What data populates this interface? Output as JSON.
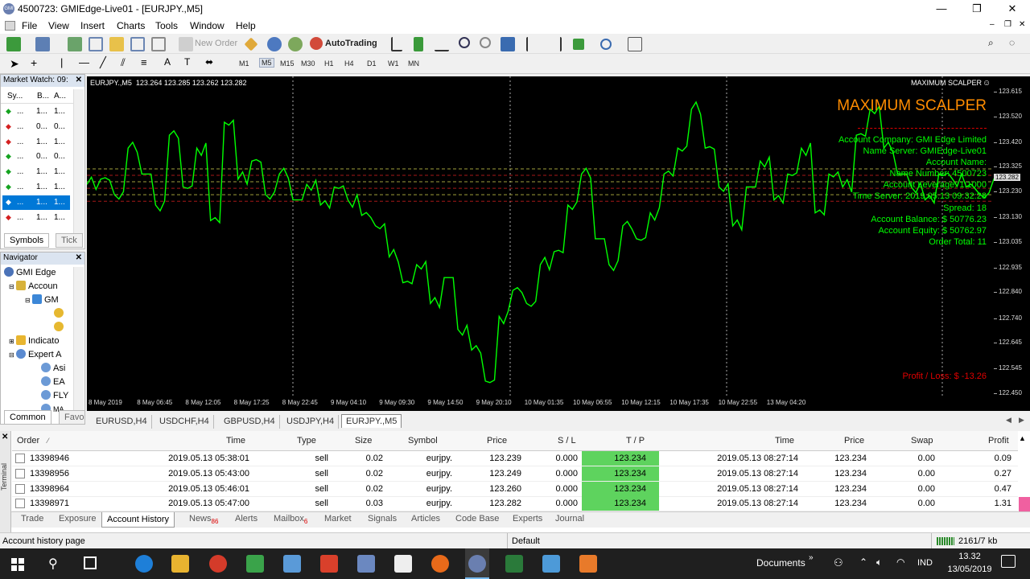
{
  "window": {
    "title": "4500723: GMIEdge-Live01 - [EURJPY.,M5]",
    "app_icon_text": "GMI",
    "minimize_glyph": "—",
    "restore_glyph": "❐",
    "close_glyph": "✕"
  },
  "menu": [
    "File",
    "View",
    "Insert",
    "Charts",
    "Tools",
    "Window",
    "Help"
  ],
  "toolbar": {
    "new_order_label": "New Order",
    "autotrading_label": "AutoTrading",
    "timeframes": [
      "M1",
      "M5",
      "M15",
      "M30",
      "H1",
      "H4",
      "D1",
      "W1",
      "MN"
    ],
    "active_timeframe": "M5"
  },
  "market_watch": {
    "title": "Market Watch: 09:",
    "columns": [
      "Sy...",
      "B...",
      "A..."
    ],
    "rows": [
      {
        "dir": "up",
        "sym": "...",
        "bid": "1...",
        "ask": "1..."
      },
      {
        "dir": "down",
        "sym": "...",
        "bid": "0...",
        "ask": "0..."
      },
      {
        "dir": "down",
        "sym": "...",
        "bid": "1...",
        "ask": "1..."
      },
      {
        "dir": "up",
        "sym": "...",
        "bid": "0...",
        "ask": "0..."
      },
      {
        "dir": "up",
        "sym": "...",
        "bid": "1...",
        "ask": "1..."
      },
      {
        "dir": "up",
        "sym": "...",
        "bid": "1...",
        "ask": "1..."
      },
      {
        "dir": "down",
        "sym": "...",
        "bid": "1...",
        "ask": "1..."
      },
      {
        "dir": "down",
        "sym": "...",
        "bid": "1...",
        "ask": "1..."
      }
    ],
    "selected_row": 6,
    "tabs": [
      "Symbols",
      "Tick"
    ]
  },
  "navigator": {
    "title": "Navigator",
    "items": [
      "GMI Edge",
      "Accoun",
      "GM",
      "Indicato",
      "Expert A",
      "Asi",
      "EA",
      "FLY",
      "MA"
    ],
    "tabs": [
      "Common",
      "Favo"
    ]
  },
  "chart": {
    "header": "EURJPY.,M5  123.264 123.285 123.262 123.282",
    "ea_label": "MAXIMUM SCALPER",
    "ea_title": "MAXIMUM SCALPER",
    "info_lines": [
      "Account Company: GMI Edge Limited",
      "Name Server: GMIEdge-Live01",
      "Account Name:",
      "Name Number: 4500723",
      "Account Leverage: 1:1000",
      "Time Server: 2019.05.13 09:32:28",
      "Spread: 18",
      "Account Balance: $ 50776.23",
      "Account Equity: $ 50762.97",
      "Order Total: 11"
    ],
    "profit_loss": "Profit / Loss: $ -13.26",
    "current_price": "123.282",
    "price_ticks": [
      "123.615",
      "123.520",
      "123.420",
      "123.325",
      "123.230",
      "123.130",
      "123.035",
      "122.935",
      "122.840",
      "122.740",
      "122.645",
      "122.545",
      "122.450"
    ],
    "time_ticks": [
      "8 May 2019",
      "8 May 06:45",
      "8 May 12:05",
      "8 May 17:25",
      "8 May 22:45",
      "9 May 04:10",
      "9 May 09:30",
      "9 May 14:50",
      "9 May 20:10",
      "10 May 01:35",
      "10 May 06:55",
      "10 May 12:15",
      "10 May 17:35",
      "10 May 22:55",
      "13 May 04:20"
    ],
    "price_series": [
      123.26,
      123.28,
      123.22,
      123.4,
      123.3,
      123.18,
      123.45,
      123.25,
      123.4,
      123.12,
      123.5,
      123.28,
      123.35,
      123.22,
      123.3,
      123.2,
      123.26,
      123.18,
      123.25,
      123.2,
      123.14,
      123.1,
      122.98,
      122.88,
      122.95,
      122.8,
      122.9,
      122.7,
      122.62,
      122.5,
      122.75,
      122.85,
      122.8,
      122.95,
      123.0,
      123.18,
      123.3,
      123.05,
      122.95,
      123.1,
      123.05,
      123.15,
      123.3,
      123.4,
      123.55,
      123.4,
      123.25,
      123.1,
      123.25,
      123.35,
      123.2,
      123.3,
      123.4,
      123.15,
      123.3,
      123.25,
      123.45,
      123.55,
      123.4,
      123.3,
      123.25,
      123.2,
      123.3,
      123.28,
      123.25,
      123.22,
      123.28
    ]
  },
  "chart_tabs": [
    "EURUSD,H4",
    "USDCHF,H4",
    "GBPUSD,H4",
    "USDJPY,H4",
    "EURJPY.,M5"
  ],
  "active_chart_tab": "EURJPY.,M5",
  "orders": {
    "columns": [
      "Order",
      "Time",
      "Type",
      "Size",
      "Symbol",
      "Price",
      "S / L",
      "T / P",
      "Time",
      "Price",
      "Swap",
      "Profit"
    ],
    "rows": [
      {
        "order": "13398946",
        "open_time": "2019.05.13 05:38:01",
        "type": "sell",
        "size": "0.02",
        "symbol": "eurjpy.",
        "price": "123.239",
        "sl": "0.000",
        "tp": "123.234",
        "close_time": "2019.05.13 08:27:14",
        "close_price": "123.234",
        "swap": "0.00",
        "profit": "0.09"
      },
      {
        "order": "13398956",
        "open_time": "2019.05.13 05:43:00",
        "type": "sell",
        "size": "0.02",
        "symbol": "eurjpy.",
        "price": "123.249",
        "sl": "0.000",
        "tp": "123.234",
        "close_time": "2019.05.13 08:27:14",
        "close_price": "123.234",
        "swap": "0.00",
        "profit": "0.27"
      },
      {
        "order": "13398964",
        "open_time": "2019.05.13 05:46:01",
        "type": "sell",
        "size": "0.02",
        "symbol": "eurjpy.",
        "price": "123.260",
        "sl": "0.000",
        "tp": "123.234",
        "close_time": "2019.05.13 08:27:14",
        "close_price": "123.234",
        "swap": "0.00",
        "profit": "0.47"
      },
      {
        "order": "13398971",
        "open_time": "2019.05.13 05:47:00",
        "type": "sell",
        "size": "0.03",
        "symbol": "eurjpy.",
        "price": "123.282",
        "sl": "0.000",
        "tp": "123.234",
        "close_time": "2019.05.13 08:27:14",
        "close_price": "123.234",
        "swap": "0.00",
        "profit": "1.31"
      }
    ]
  },
  "terminal": {
    "side_label": "Terminal",
    "tabs": [
      {
        "label": "Trade",
        "badge": ""
      },
      {
        "label": "Exposure",
        "badge": ""
      },
      {
        "label": "Account History",
        "badge": ""
      },
      {
        "label": "News",
        "badge": "86"
      },
      {
        "label": "Alerts",
        "badge": ""
      },
      {
        "label": "Mailbox",
        "badge": "6"
      },
      {
        "label": "Market",
        "badge": ""
      },
      {
        "label": "Signals",
        "badge": ""
      },
      {
        "label": "Articles",
        "badge": ""
      },
      {
        "label": "Code Base",
        "badge": ""
      },
      {
        "label": "Experts",
        "badge": ""
      },
      {
        "label": "Journal",
        "badge": ""
      }
    ],
    "active_tab": "Account History"
  },
  "status": {
    "left": "Account history page",
    "profile": "Default",
    "traffic": "2161/7 kb"
  },
  "taskbar": {
    "documents_label": "Documents",
    "lang": "IND",
    "time": "13.32",
    "date": "13/05/2019"
  },
  "colors": {
    "chart_bg": "#000000",
    "price_line": "#00ff00",
    "ea_title": "#ff8c00",
    "info_text": "#00ff00",
    "profit_loss": "#ff0000",
    "tp_highlight": "#5ed35e",
    "selection": "#0078d7"
  }
}
